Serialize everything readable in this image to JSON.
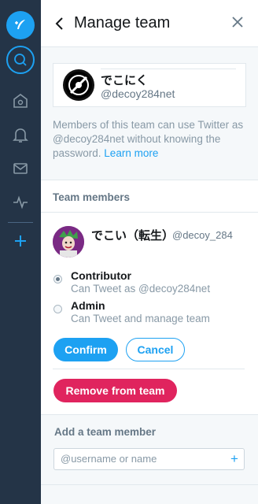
{
  "accent_color": "#1da1f2",
  "danger_color": "#e0245e",
  "rail": {
    "background": "#243447",
    "items": [
      {
        "icon": "feather-compose-icon"
      },
      {
        "icon": "search-icon"
      },
      {
        "icon": "home-icon"
      },
      {
        "icon": "notifications-bell-icon"
      },
      {
        "icon": "messages-mail-icon"
      },
      {
        "icon": "activity-icon"
      },
      {
        "icon": "plus-add-column-icon"
      }
    ]
  },
  "header": {
    "title": "Manage team",
    "back_icon": "chevron-left-icon",
    "close_icon": "close-icon"
  },
  "account": {
    "name": "でこにく",
    "handle": "@decoy284net"
  },
  "info": {
    "text": "Members of this team can use Twitter as @decoy284net without knowing the password.",
    "link": "Learn more"
  },
  "team_members": {
    "heading": "Team members",
    "member": {
      "name": "でこい（転生）",
      "handle": "@decoy_284"
    },
    "roles": [
      {
        "title": "Contributor",
        "description": "Can Tweet as @decoy284net",
        "selected": true
      },
      {
        "title": "Admin",
        "description": "Can Tweet and manage team",
        "selected": false
      }
    ],
    "confirm_label": "Confirm",
    "cancel_label": "Cancel",
    "remove_label": "Remove from team"
  },
  "add_member": {
    "heading": "Add a team member",
    "placeholder": "@username or name",
    "value": ""
  }
}
